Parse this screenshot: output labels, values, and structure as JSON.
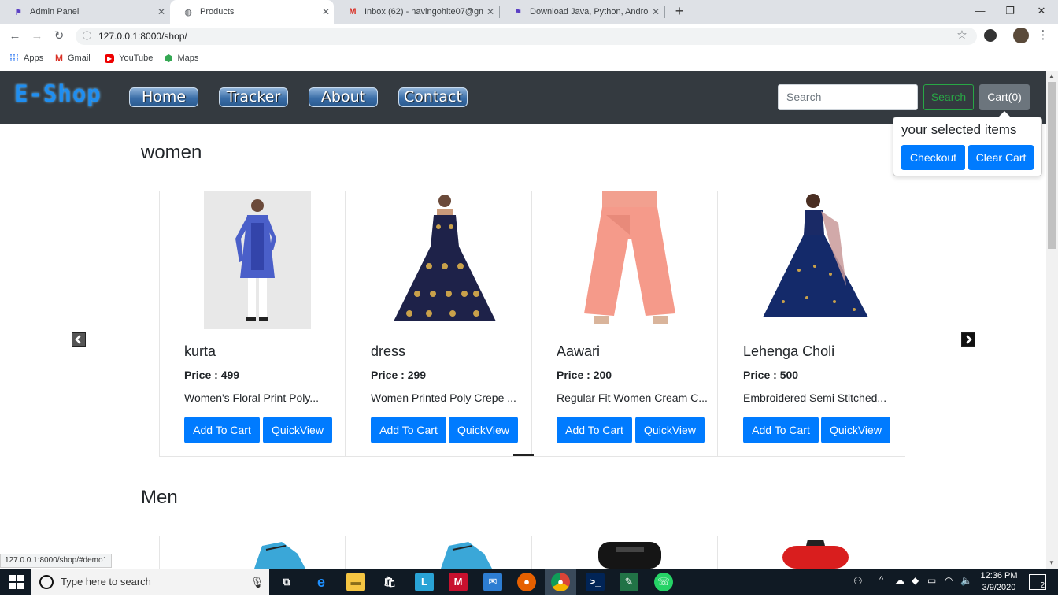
{
  "browser": {
    "tabs": [
      {
        "title": "Admin Panel",
        "icon": "django-icon"
      },
      {
        "title": "Products",
        "icon": "globe-icon"
      },
      {
        "title": "Inbox (62) - navingohite07@gma",
        "icon": "gmail-icon"
      },
      {
        "title": "Download Java, Python, Android",
        "icon": "flag-icon"
      }
    ],
    "url": "127.0.0.1:8000/shop/",
    "bookmarks": [
      {
        "label": "Apps"
      },
      {
        "label": "Gmail"
      },
      {
        "label": "YouTube"
      },
      {
        "label": "Maps"
      }
    ],
    "status_url": "127.0.0.1:8000/shop/#demo1"
  },
  "navbar": {
    "brand": "E-Shop",
    "links": [
      "Home",
      "Tracker",
      "About",
      "Contact"
    ],
    "search_placeholder": "Search",
    "search_button": "Search",
    "cart_button": "Cart(0)"
  },
  "popover": {
    "title": "your selected items",
    "checkout": "Checkout",
    "clear": "Clear Cart"
  },
  "sections": [
    {
      "title": "women",
      "products": [
        {
          "name": "kurta",
          "price": "Price : 499",
          "desc": "Women's Floral Print Poly...",
          "add": "Add To Cart",
          "view": "QuickView"
        },
        {
          "name": "dress",
          "price": "Price : 299",
          "desc": "Women Printed Poly Crepe ...",
          "add": "Add To Cart",
          "view": "QuickView"
        },
        {
          "name": "Aawari",
          "price": "Price : 200",
          "desc": "Regular Fit Women Cream C...",
          "add": "Add To Cart",
          "view": "QuickView"
        },
        {
          "name": "Lehenga Choli",
          "price": "Price : 500",
          "desc": "Embroidered Semi Stitched...",
          "add": "Add To Cart",
          "view": "QuickView"
        }
      ]
    },
    {
      "title": "Men"
    }
  ],
  "taskbar": {
    "search_placeholder": "Type here to search",
    "time": "12:36 PM",
    "date": "3/9/2020",
    "notifications": "2"
  },
  "colors": {
    "navbar": "#343a40",
    "primary": "#007bff",
    "success": "#28a745",
    "secondary": "#6c757d"
  }
}
